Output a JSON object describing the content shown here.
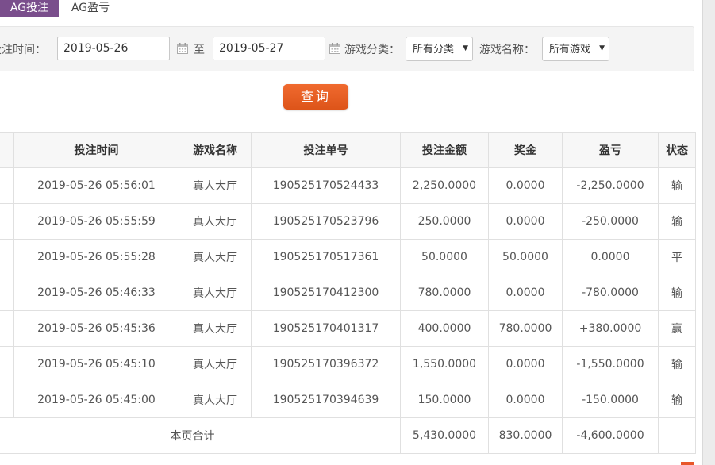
{
  "tabs": [
    {
      "label": "AG投注",
      "active": true
    },
    {
      "label": "AG盈亏",
      "active": false
    }
  ],
  "filters": {
    "bet_time_label": "投注时间：",
    "date_from": "2019-05-26",
    "to_label": "至",
    "date_to": "2019-05-27",
    "game_category_label": "游戏分类：",
    "game_category_value": "所有分类",
    "game_name_label": "游戏名称：",
    "game_name_value": "所有游戏",
    "query_button": "查询"
  },
  "table": {
    "columns": [
      "投注时间",
      "游戏名称",
      "投注单号",
      "投注金额",
      "奖金",
      "盈亏",
      "状态"
    ],
    "rows": [
      {
        "time": "2019-05-26 05:56:01",
        "game": "真人大厅",
        "order": "190525170524433",
        "amount": "2,250.0000",
        "bonus": "0.0000",
        "profit": "-2,250.0000",
        "status": "输"
      },
      {
        "time": "2019-05-26 05:55:59",
        "game": "真人大厅",
        "order": "190525170523796",
        "amount": "250.0000",
        "bonus": "0.0000",
        "profit": "-250.0000",
        "status": "输"
      },
      {
        "time": "2019-05-26 05:55:28",
        "game": "真人大厅",
        "order": "190525170517361",
        "amount": "50.0000",
        "bonus": "50.0000",
        "profit": "0.0000",
        "status": "平"
      },
      {
        "time": "2019-05-26 05:46:33",
        "game": "真人大厅",
        "order": "190525170412300",
        "amount": "780.0000",
        "bonus": "0.0000",
        "profit": "-780.0000",
        "status": "输"
      },
      {
        "time": "2019-05-26 05:45:36",
        "game": "真人大厅",
        "order": "190525170401317",
        "amount": "400.0000",
        "bonus": "780.0000",
        "profit": "+380.0000",
        "status": "赢"
      },
      {
        "time": "2019-05-26 05:45:10",
        "game": "真人大厅",
        "order": "190525170396372",
        "amount": "1,550.0000",
        "bonus": "0.0000",
        "profit": "-1,550.0000",
        "status": "输"
      },
      {
        "time": "2019-05-26 05:45:00",
        "game": "真人大厅",
        "order": "190525170394639",
        "amount": "150.0000",
        "bonus": "0.0000",
        "profit": "-150.0000",
        "status": "输"
      }
    ],
    "summary": {
      "label": "本页合计",
      "amount": "5,430.0000",
      "bonus": "830.0000",
      "profit": "-4,600.0000"
    }
  },
  "colors": {
    "tab_active_bg": "#7a4e8c",
    "query_button_bg": "#e85a20",
    "loss": "#cc2222",
    "win": "#2a8a2a"
  }
}
